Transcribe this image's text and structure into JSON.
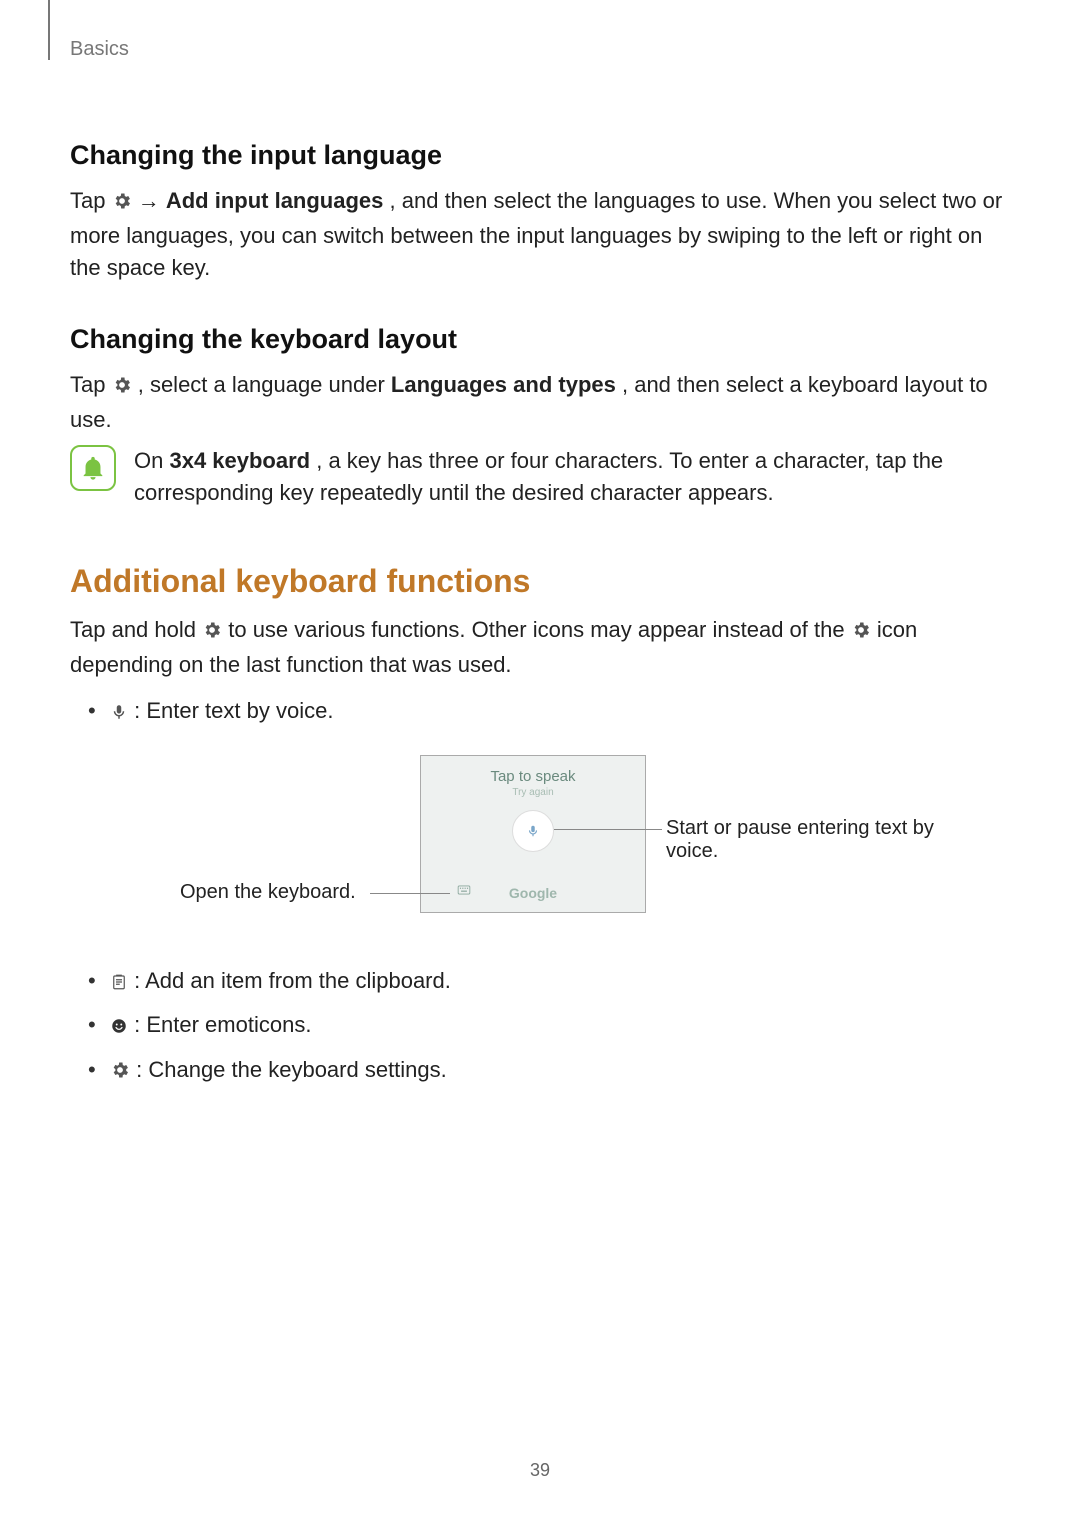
{
  "header": {
    "section": "Basics"
  },
  "s1": {
    "heading": "Changing the input language",
    "p_before_gear": "Tap ",
    "p_between": " → ",
    "p_bold": "Add input languages",
    "p_after": ", and then select the languages to use. When you select two or more languages, you can switch between the input languages by swiping to the left or right on the space key."
  },
  "s2": {
    "heading": "Changing the keyboard layout",
    "p_before_gear": "Tap ",
    "p_mid": ", select a language under ",
    "p_bold": "Languages and types",
    "p_after": ", and then select a keyboard layout to use."
  },
  "note": {
    "before_bold": "On ",
    "bold": "3x4 keyboard",
    "after_bold": ", a key has three or four characters. To enter a character, tap the corresponding key repeatedly until the desired character appears."
  },
  "s3": {
    "heading": "Additional keyboard functions",
    "p_a": "Tap and hold ",
    "p_b": " to use various functions. Other icons may appear instead of the ",
    "p_c": " icon depending on the last function that was used."
  },
  "list": {
    "mic": " : Enter text by voice.",
    "clip": " : Add an item from the clipboard.",
    "emot": " : Enter emoticons.",
    "gear": " : Change the keyboard settings."
  },
  "diagram": {
    "tap_to_speak": "Tap to speak",
    "try_again": "Try again",
    "google": "Google",
    "left_callout": "Open the keyboard.",
    "right_callout": "Start or pause entering text by voice."
  },
  "page_number": "39"
}
